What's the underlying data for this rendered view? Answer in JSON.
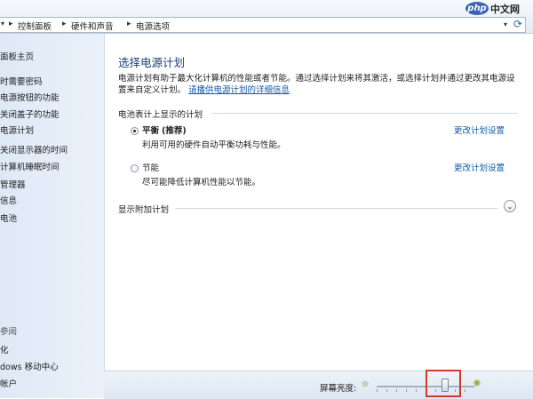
{
  "breadcrumb": {
    "items": [
      "控制面板",
      "硬件和声音",
      "电源选项"
    ]
  },
  "logo": {
    "mark": "php",
    "text": "中文网"
  },
  "sidebar": {
    "home": "面板主页",
    "links": [
      "时需要密码",
      "电源按钮的功能",
      "关闭盖子的功能",
      "电源计划",
      "关闭显示器的时间",
      "计算机睡眠时间",
      "管理器",
      "信息",
      "电池"
    ],
    "see_also_title": "参阅",
    "see_also": [
      "化",
      "dows 移动中心",
      "帐户"
    ]
  },
  "main": {
    "title": "选择电源计划",
    "intro": "电源计划有助于最大化计算机的性能或者节能。通过选择计划来将其激活，或选择计划并通过更改其电源设置来自定义计划。",
    "intro_link": "请播供电源计划的详细信息",
    "section_title": "电池表计上显示的计划",
    "plans": [
      {
        "name": "平衡",
        "tag": "(推荐)",
        "desc": "利用可用的硬件自动平衡功耗与性能。",
        "link": "更改计划设置",
        "selected": true
      },
      {
        "name": "节能",
        "tag": "",
        "desc": "尽可能降低计算机性能以节能。",
        "link": "更改计划设置",
        "selected": false
      }
    ],
    "additional_plans": "显示附加计划"
  },
  "bottom": {
    "brightness_label": "屏幕亮度:",
    "brightness_level": 0.7
  },
  "icons": {
    "expand": "chevron-down-icon",
    "refresh": "refresh-icon",
    "sun_small": "sun-small-icon",
    "sun_large": "sun-large-icon"
  },
  "colors": {
    "link": "#0f5aa6",
    "title": "#1e3c78",
    "sidebar": "#dfe9f6",
    "highlight": "#d03a2a"
  }
}
